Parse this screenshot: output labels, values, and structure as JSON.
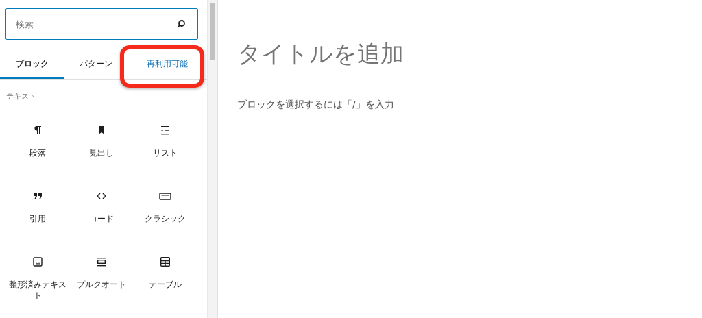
{
  "search": {
    "placeholder": "検索"
  },
  "tabs": [
    {
      "label": "ブロック",
      "selected": true,
      "highlighted": false
    },
    {
      "label": "パターン",
      "selected": false,
      "highlighted": false
    },
    {
      "label": "再利用可能",
      "selected": false,
      "highlighted": true
    }
  ],
  "section_title": "テキスト",
  "blocks": [
    {
      "label": "段落"
    },
    {
      "label": "見出し"
    },
    {
      "label": "リスト"
    },
    {
      "label": "引用"
    },
    {
      "label": "コード"
    },
    {
      "label": "クラシック"
    },
    {
      "label": "整形済みテキスト"
    },
    {
      "label": "プルクオート"
    },
    {
      "label": "テーブル"
    }
  ],
  "editor": {
    "title_placeholder": "タイトルを追加",
    "body_placeholder": "ブロックを選択するには「/」を入力"
  }
}
